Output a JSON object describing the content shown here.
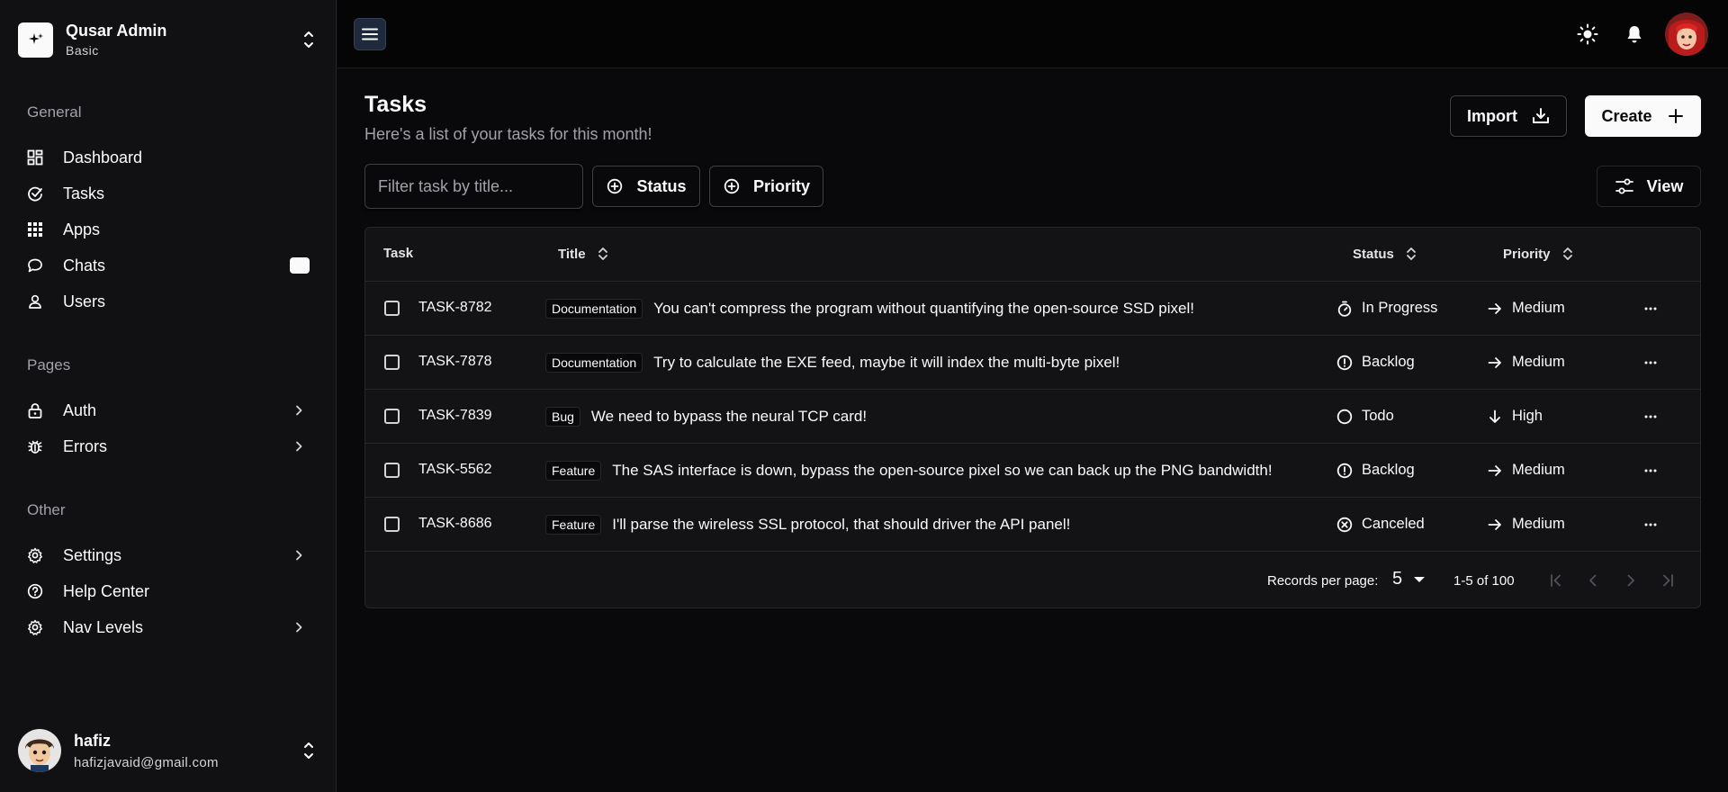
{
  "brand": {
    "name": "Qusar Admin",
    "plan": "Basic"
  },
  "nav": {
    "general": {
      "heading": "General",
      "items": [
        {
          "label": "Dashboard",
          "icon": "dashboard-icon"
        },
        {
          "label": "Tasks",
          "icon": "tasks-icon"
        },
        {
          "label": "Apps",
          "icon": "apps-icon"
        },
        {
          "label": "Chats",
          "icon": "chat-icon",
          "badge": true
        },
        {
          "label": "Users",
          "icon": "user-icon"
        }
      ]
    },
    "pages": {
      "heading": "Pages",
      "items": [
        {
          "label": "Auth",
          "icon": "lock-icon",
          "chevron": true
        },
        {
          "label": "Errors",
          "icon": "bug-icon",
          "chevron": true
        }
      ]
    },
    "other": {
      "heading": "Other",
      "items": [
        {
          "label": "Settings",
          "icon": "gear-icon",
          "chevron": true
        },
        {
          "label": "Help Center",
          "icon": "help-icon"
        },
        {
          "label": "Nav Levels",
          "icon": "gear-icon",
          "chevron": true
        }
      ]
    }
  },
  "user": {
    "name": "hafiz",
    "email": "hafizjavaid@gmail.com"
  },
  "page": {
    "title": "Tasks",
    "subtitle": "Here's a list of your tasks for this month!"
  },
  "actions": {
    "import_label": "Import",
    "create_label": "Create"
  },
  "filters": {
    "search_placeholder": "Filter task by title...",
    "status_label": "Status",
    "priority_label": "Priority",
    "view_label": "View"
  },
  "table": {
    "columns": {
      "task": "Task",
      "title": "Title",
      "status": "Status",
      "priority": "Priority"
    },
    "rows": [
      {
        "id": "TASK-8782",
        "label": "Documentation",
        "title": "You can't compress the program without quantifying the open-source SSD pixel!",
        "status": "In Progress",
        "status_icon": "timer-icon",
        "priority": "Medium",
        "priority_icon": "arrow-right-icon"
      },
      {
        "id": "TASK-7878",
        "label": "Documentation",
        "title": "Try to calculate the EXE feed, maybe it will index the multi-byte pixel!",
        "status": "Backlog",
        "status_icon": "alert-circle-icon",
        "priority": "Medium",
        "priority_icon": "arrow-right-icon"
      },
      {
        "id": "TASK-7839",
        "label": "Bug",
        "title": "We need to bypass the neural TCP card!",
        "status": "Todo",
        "status_icon": "circle-icon",
        "priority": "High",
        "priority_icon": "arrow-down-icon"
      },
      {
        "id": "TASK-5562",
        "label": "Feature",
        "title": "The SAS interface is down, bypass the open-source pixel so we can back up the PNG bandwidth!",
        "status": "Backlog",
        "status_icon": "alert-circle-icon",
        "priority": "Medium",
        "priority_icon": "arrow-right-icon"
      },
      {
        "id": "TASK-8686",
        "label": "Feature",
        "title": "I'll parse the wireless SSL protocol, that should driver the API panel!",
        "status": "Canceled",
        "status_icon": "x-circle-icon",
        "priority": "Medium",
        "priority_icon": "arrow-right-icon"
      }
    ]
  },
  "pagination": {
    "records_label": "Records per page:",
    "per_page": "5",
    "range": "1-5 of 100"
  }
}
